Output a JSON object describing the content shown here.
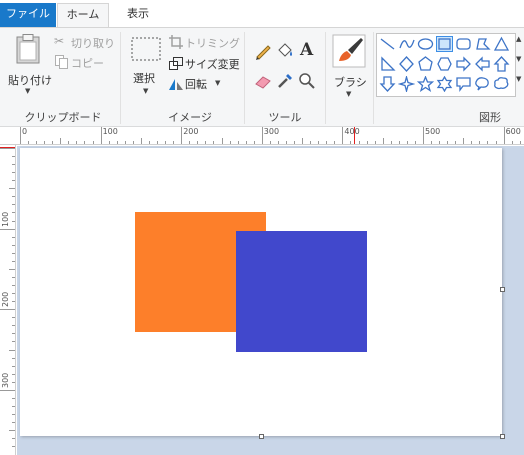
{
  "tabs": {
    "file": "ファイル",
    "home": "ホーム",
    "view": "表示"
  },
  "clipboard": {
    "paste": "貼り付け",
    "cut": "切り取り",
    "copy": "コピー",
    "group": "クリップボード"
  },
  "image": {
    "select": "選択",
    "crop": "トリミング",
    "resize": "サイズ変更",
    "rotate": "回転",
    "group": "イメージ"
  },
  "tools": {
    "group": "ツール"
  },
  "brush": {
    "label": "ブラシ"
  },
  "shapes": {
    "group": "図形"
  },
  "ruler": {
    "h_marks": [
      "0",
      "100",
      "200",
      "300",
      "400",
      "500",
      "600"
    ],
    "v_marks": [
      "100",
      "200",
      "300"
    ]
  },
  "canvas_shapes": {
    "orange_color": "#fd7f2a",
    "blue_color": "#4148cc"
  },
  "colors": {
    "accent": "#1979ca",
    "ruler_marker": "#e02020",
    "workspace": "#c9d6e8"
  }
}
